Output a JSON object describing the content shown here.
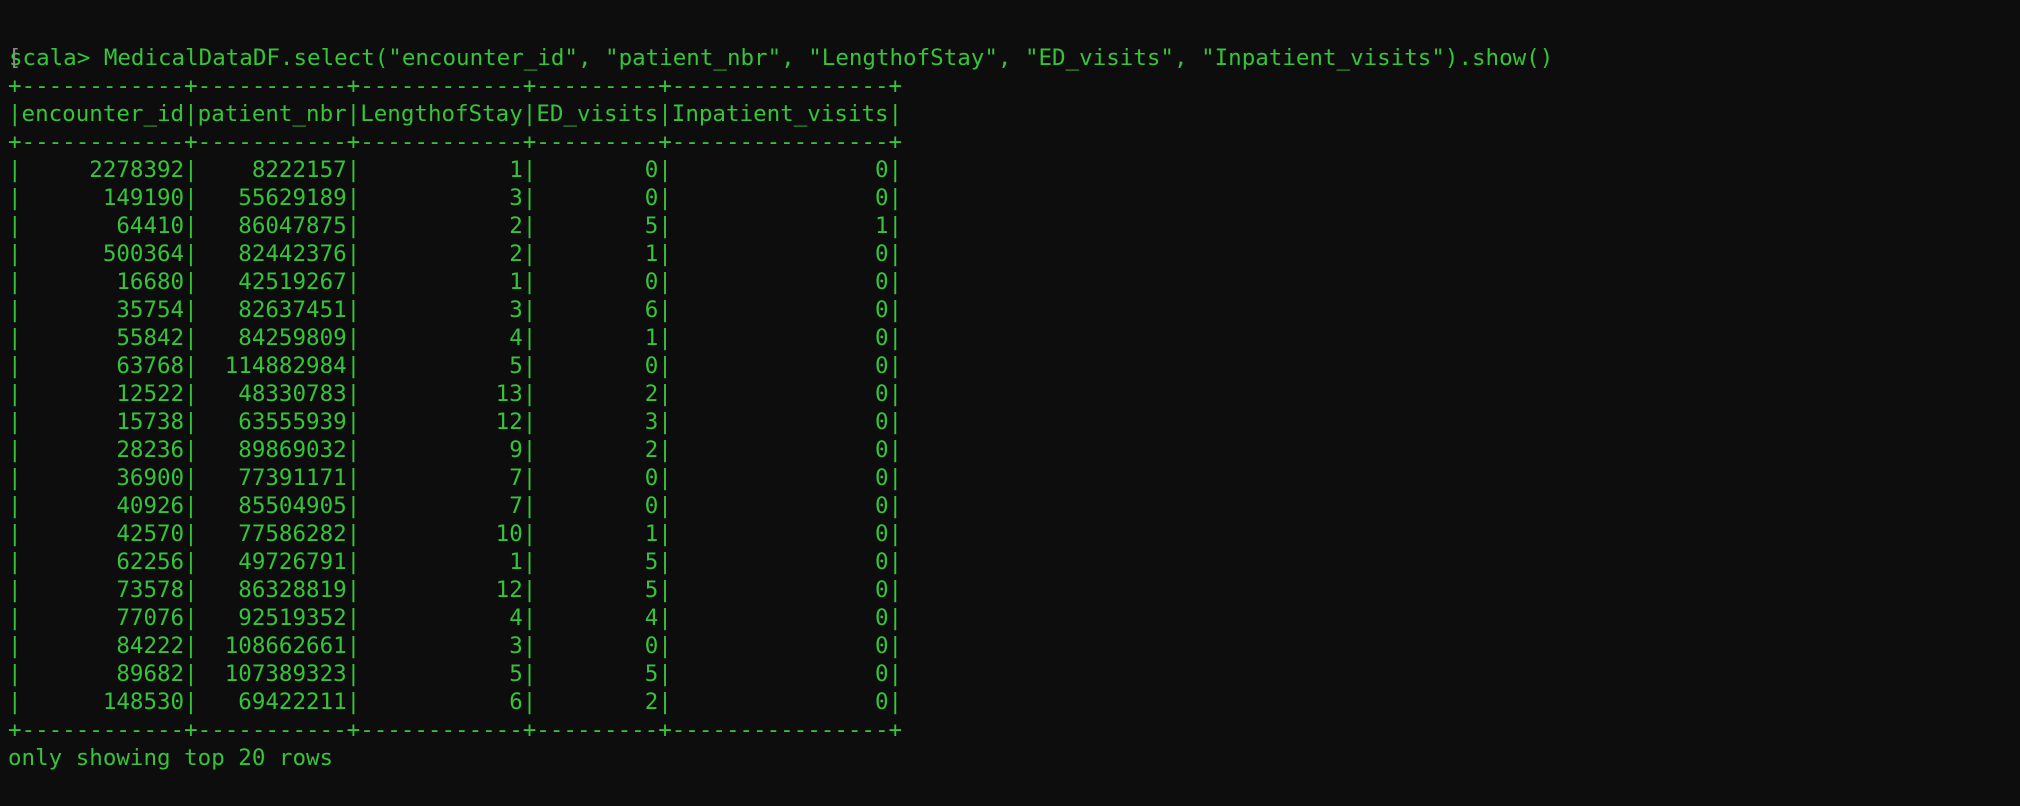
{
  "window": {
    "background": "#0d0d0d",
    "text_color": "#35c43a"
  },
  "prompt": {
    "text": "scala>",
    "command": "MedicalDataDF.select(\"encounter_id\", \"patient_nbr\", \"LengthofStay\", \"ED_visits\", \"Inpatient_visits\").show()"
  },
  "table": {
    "columns": [
      {
        "name": "encounter_id",
        "width": 12
      },
      {
        "name": "patient_nbr",
        "width": 11
      },
      {
        "name": "LengthofStay",
        "width": 12
      },
      {
        "name": "ED_visits",
        "width": 9
      },
      {
        "name": "Inpatient_visits",
        "width": 16
      }
    ],
    "rows": [
      [
        "2278392",
        "8222157",
        "1",
        "0",
        "0"
      ],
      [
        "149190",
        "55629189",
        "3",
        "0",
        "0"
      ],
      [
        "64410",
        "86047875",
        "2",
        "5",
        "1"
      ],
      [
        "500364",
        "82442376",
        "2",
        "1",
        "0"
      ],
      [
        "16680",
        "42519267",
        "1",
        "0",
        "0"
      ],
      [
        "35754",
        "82637451",
        "3",
        "6",
        "0"
      ],
      [
        "55842",
        "84259809",
        "4",
        "1",
        "0"
      ],
      [
        "63768",
        "114882984",
        "5",
        "0",
        "0"
      ],
      [
        "12522",
        "48330783",
        "13",
        "2",
        "0"
      ],
      [
        "15738",
        "63555939",
        "12",
        "3",
        "0"
      ],
      [
        "28236",
        "89869032",
        "9",
        "2",
        "0"
      ],
      [
        "36900",
        "77391171",
        "7",
        "0",
        "0"
      ],
      [
        "40926",
        "85504905",
        "7",
        "0",
        "0"
      ],
      [
        "42570",
        "77586282",
        "10",
        "1",
        "0"
      ],
      [
        "62256",
        "49726791",
        "1",
        "5",
        "0"
      ],
      [
        "73578",
        "86328819",
        "12",
        "5",
        "0"
      ],
      [
        "77076",
        "92519352",
        "4",
        "4",
        "0"
      ],
      [
        "84222",
        "108662661",
        "3",
        "0",
        "0"
      ],
      [
        "89682",
        "107389323",
        "5",
        "5",
        "0"
      ],
      [
        "148530",
        "69422211",
        "6",
        "2",
        "0"
      ]
    ]
  },
  "footer": {
    "text": "only showing top 20 rows"
  }
}
